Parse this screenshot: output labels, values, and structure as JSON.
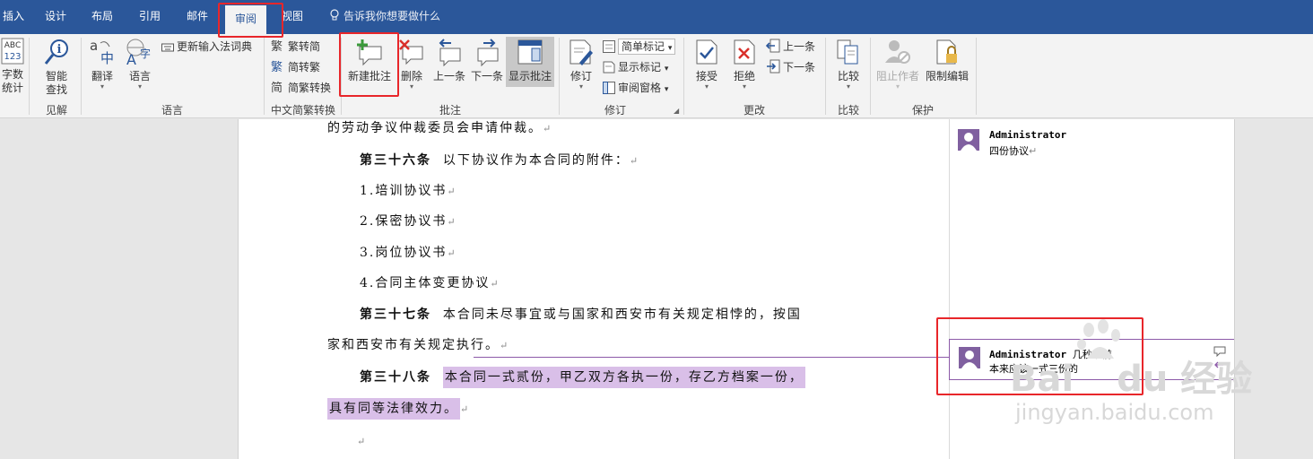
{
  "tabs": [
    "插入",
    "设计",
    "布局",
    "引用",
    "邮件",
    "审阅",
    "视图"
  ],
  "tell_me": "告诉我你想要做什么",
  "ribbon": {
    "proofing": {
      "word_count": "字数统计",
      "word_count_icon_text": "ABC\n123"
    },
    "insights": {
      "smart_lookup": "智能查找",
      "group": "见解"
    },
    "language": {
      "translate": "翻译",
      "language": "语言",
      "update_ime": "更新输入法词典",
      "group": "语言"
    },
    "chinese": {
      "to_simplified": "繁转简",
      "to_traditional": "简转繁",
      "convert": "简繁转换",
      "group": "中文简繁转换"
    },
    "comments": {
      "new": "新建批注",
      "delete": "删除",
      "prev": "上一条",
      "next": "下一条",
      "show": "显示批注",
      "group": "批注"
    },
    "tracking": {
      "track": "修订",
      "simple_markup": "简单标记",
      "show_markup": "显示标记",
      "review_pane": "审阅窗格",
      "group": "修订"
    },
    "changes": {
      "accept": "接受",
      "reject": "拒绝",
      "prev": "上一条",
      "next": "下一条",
      "group": "更改"
    },
    "compare": {
      "compare": "比较",
      "group": "比较"
    },
    "protect": {
      "block_authors": "阻止作者",
      "restrict": "限制编辑",
      "group": "保护"
    }
  },
  "document": {
    "line1": "的劳动争议仲裁委员会申请仲裁。",
    "art36_head": "第三十六条",
    "art36_text": "以下协议作为本合同的附件：",
    "item1": "1.培训协议书",
    "item2": "2.保密协议书",
    "item3": "3.岗位协议书",
    "item4": "4.合同主体变更协议",
    "art37_head": "第三十七条",
    "art37_text": "本合同未尽事宜或与国家和西安市有关规定相悖的，按国",
    "art37_cont": "家和西安市有关规定执行。",
    "art38_head": "第三十八条",
    "art38_text": "本合同一式贰份，甲乙双方各执一份，存乙方档案一份，",
    "art38_cont": "具有同等法律效力。",
    "para_mark": "↵"
  },
  "comments": [
    {
      "author": "Administrator",
      "time": "",
      "text": "四份协议"
    },
    {
      "author": "Administrator",
      "time": "几秒以前",
      "text": "本来应该一式三份的"
    }
  ],
  "colors": {
    "accent": "#2b579a",
    "highlight": "#d9bfe8",
    "callout": "#e8262a"
  },
  "watermark": {
    "logo": "Bai du 经验",
    "url": "jingyan.baidu.com"
  }
}
